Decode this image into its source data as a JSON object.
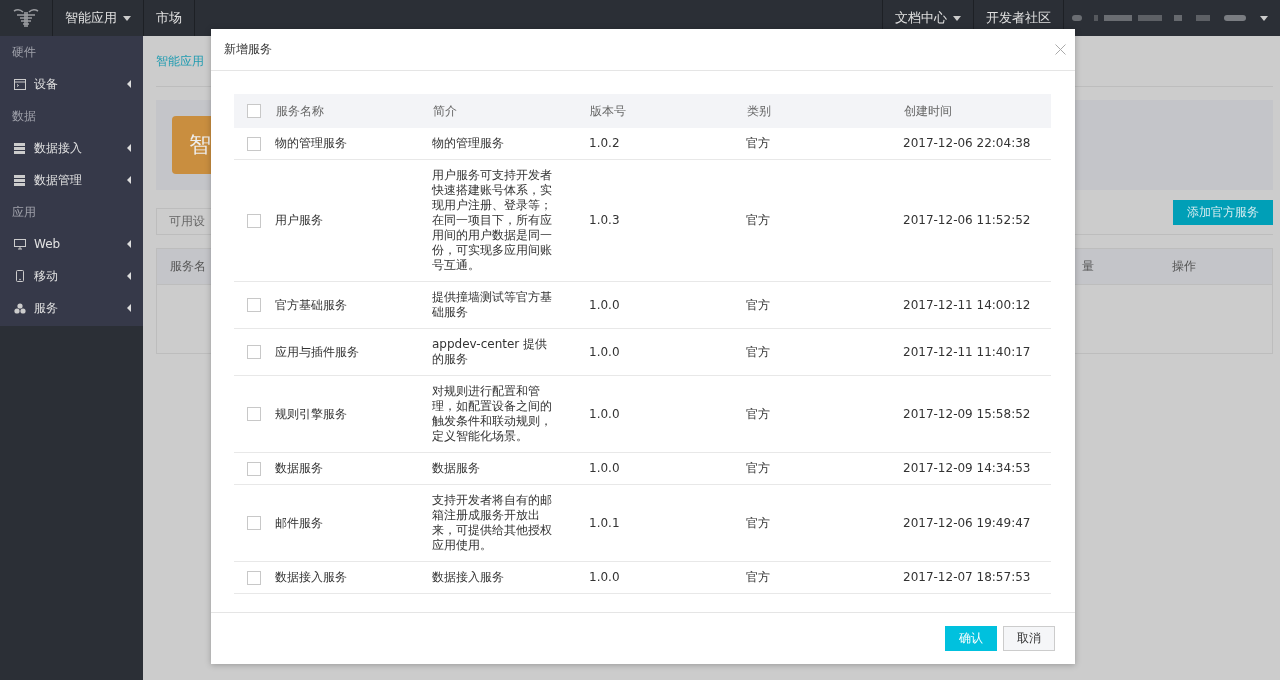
{
  "topbar": {
    "menus": [
      {
        "label": "智能应用",
        "dropdown": true
      },
      {
        "label": "市场",
        "dropdown": false
      }
    ],
    "right_menus": [
      {
        "label": "文档中心",
        "dropdown": true
      },
      {
        "label": "开发者社区",
        "dropdown": false
      }
    ]
  },
  "sidebar": {
    "sections": [
      {
        "title": "硬件",
        "items": [
          {
            "label": "设备"
          }
        ]
      },
      {
        "title": "数据",
        "items": [
          {
            "label": "数据接入"
          },
          {
            "label": "数据管理"
          }
        ]
      },
      {
        "title": "应用",
        "items": [
          {
            "label": "Web"
          },
          {
            "label": "移动"
          },
          {
            "label": "服务"
          }
        ]
      }
    ]
  },
  "page": {
    "breadcrumb": "智能应用",
    "banner_letter": "智",
    "tab": "可用设",
    "add_button": "添加官方服务",
    "table_columns": [
      "服务名",
      "量",
      "操作"
    ]
  },
  "dialog": {
    "title": "新增服务",
    "columns": [
      "服务名称",
      "简介",
      "版本号",
      "类别",
      "创建时间"
    ],
    "all_checked": false,
    "rows": [
      {
        "checked": false,
        "name": "物的管理服务",
        "description": "物的管理服务",
        "version": "1.0.2",
        "category": "官方",
        "created": "2017-12-06 22:04:38"
      },
      {
        "checked": false,
        "name": "用户服务",
        "description": "用户服务可支持开发者快速搭建账号体系，实现用户注册、登录等；在同一项目下，所有应用间的用户数据是同一份，可实现多应用间账号互通。",
        "version": "1.0.3",
        "category": "官方",
        "created": "2017-12-06 11:52:52"
      },
      {
        "checked": false,
        "name": "官方基础服务",
        "description": "提供撞墙测试等官方基础服务",
        "version": "1.0.0",
        "category": "官方",
        "created": "2017-12-11 14:00:12"
      },
      {
        "checked": false,
        "name": "应用与插件服务",
        "description": "appdev-center 提供的服务",
        "version": "1.0.0",
        "category": "官方",
        "created": "2017-12-11 11:40:17"
      },
      {
        "checked": false,
        "name": "规则引擎服务",
        "description": "对规则进行配置和管理，如配置设备之间的触发条件和联动规则，定义智能化场景。",
        "version": "1.0.0",
        "category": "官方",
        "created": "2017-12-09 15:58:52"
      },
      {
        "checked": false,
        "name": "数据服务",
        "description": "数据服务",
        "version": "1.0.0",
        "category": "官方",
        "created": "2017-12-09 14:34:53"
      },
      {
        "checked": false,
        "name": "邮件服务",
        "description": "支持开发者将自有的邮箱注册成服务开放出来，可提供给其他授权应用使用。",
        "version": "1.0.1",
        "category": "官方",
        "created": "2017-12-06 19:49:47"
      },
      {
        "checked": false,
        "name": "数据接入服务",
        "description": "数据接入服务",
        "version": "1.0.0",
        "category": "官方",
        "created": "2017-12-07 18:57:53"
      }
    ],
    "buttons": [
      {
        "label": "确认",
        "kind": "primary"
      },
      {
        "label": "取消",
        "kind": "default"
      }
    ]
  }
}
